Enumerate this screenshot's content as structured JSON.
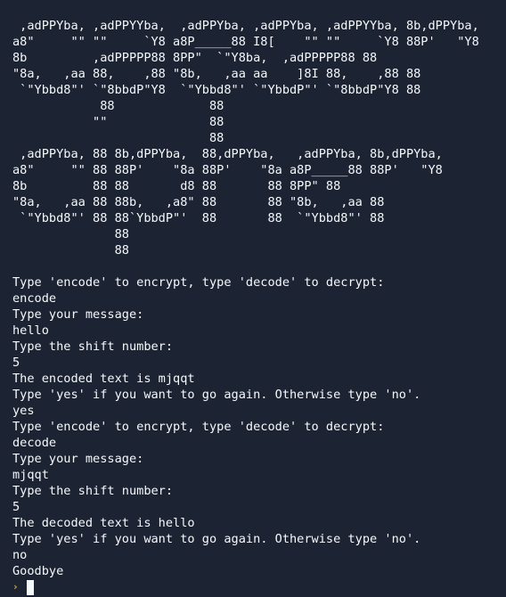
{
  "banner": {
    "art": " ,adPPYba, ,adPPYYba,  ,adPPYba, ,adPPYba, ,adPPYYba, 8b,dPPYba,\na8\"     \"\" \"\"     `Y8 a8P_____88 I8[    \"\" \"\"     `Y8 88P'   \"Y8\n8b         ,adPPPPP88 8PP\"  `\"Y8ba,  ,adPPPPP88 88\n\"8a,   ,aa 88,    ,88 \"8b,   ,aa aa    ]8I 88,    ,88 88\n `\"Ybbd8\"' `\"8bbdP\"Y8  `\"Ybbd8\"' `\"YbbdP\"' `\"8bbdP\"Y8 88\n            88             88\n           \"\"              88\n                           88\n ,adPPYba, 88 8b,dPPYba,  88,dPPYba,   ,adPPYba, 8b,dPPYba,\na8\"     \"\" 88 88P'    \"8a 88P'    \"8a a8P_____88 88P'   \"Y8\n8b         88 88       d8 88       88 8PP\" 88\n\"8a,   ,aa 88 88b,   ,a8\" 88       88 \"8b,   ,aa 88\n `\"Ybbd8\"' 88 88`YbbdP\"'  88       88  `\"Ybbd8\"' 88\n              88\n              88"
  },
  "session": {
    "lines": [
      "Type 'encode' to encrypt, type 'decode' to decrypt:",
      "encode",
      "Type your message:",
      "hello",
      "Type the shift number:",
      "5",
      "The encoded text is mjqqt",
      "Type 'yes' if you want to go again. Otherwise type 'no'.",
      "yes",
      "Type 'encode' to encrypt, type 'decode' to decrypt:",
      "decode",
      "Type your message:",
      "mjqqt",
      "Type the shift number:",
      "5",
      "The decoded text is hello",
      "Type 'yes' if you want to go again. Otherwise type 'no'.",
      "no",
      "Goodbye"
    ]
  },
  "prompt": {
    "glyph": "›",
    "icon": "prompt-chevron-icon"
  },
  "colors": {
    "background": "#1c2333",
    "text": "#f5f9fc",
    "prompt": "#f5c84b"
  }
}
